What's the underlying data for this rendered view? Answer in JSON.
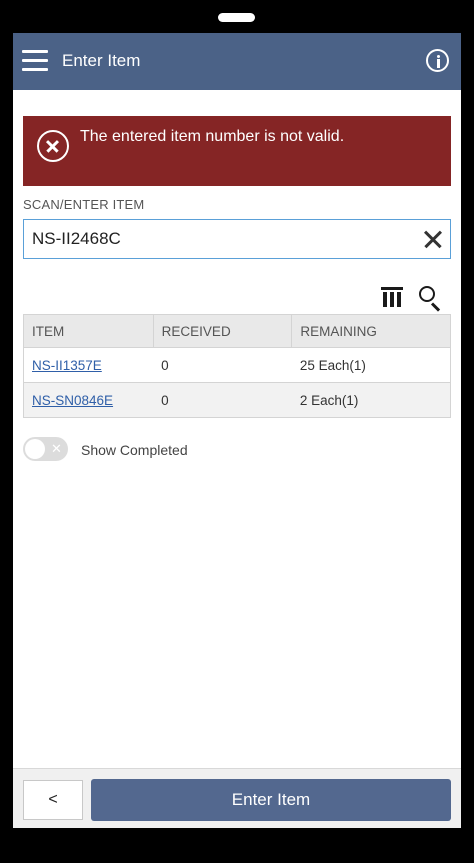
{
  "header": {
    "title": "Enter Item",
    "menu_icon": "hamburger-menu-icon",
    "info_icon": "info-icon"
  },
  "error": {
    "message": "The entered item number is not valid.",
    "icon": "error-circle-x-icon"
  },
  "scan": {
    "label": "SCAN/ENTER ITEM",
    "value": "NS-II2468C",
    "clear_icon": "clear-x-icon"
  },
  "toolbar": {
    "columns_icon": "columns-icon",
    "search_icon": "search-icon"
  },
  "table": {
    "headers": [
      "ITEM",
      "RECEIVED",
      "REMAINING"
    ],
    "rows": [
      {
        "item": "NS-II1357E",
        "received": "0",
        "remaining": "25 Each(1)"
      },
      {
        "item": "NS-SN0846E",
        "received": "0",
        "remaining": "2 Each(1)"
      }
    ]
  },
  "toggle": {
    "label": "Show Completed",
    "on": false,
    "off_glyph": "✕"
  },
  "footer": {
    "back_label": "<",
    "enter_label": "Enter Item"
  },
  "colors": {
    "header": "#4b6287",
    "error": "#852525",
    "primary_button": "#53688f",
    "link": "#2f5fa8"
  }
}
